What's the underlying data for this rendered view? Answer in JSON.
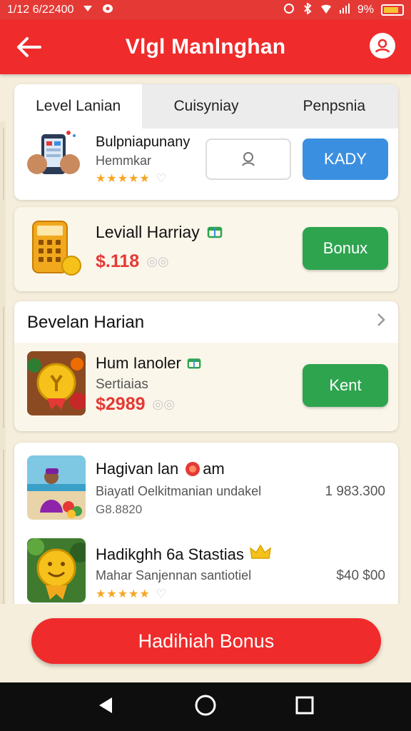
{
  "status_bar": {
    "time": "1/12 6/22400",
    "battery": "9%"
  },
  "header": {
    "title": "Vlgl Manlnghan",
    "back_icon": "arrow-left-icon",
    "profile_icon": "user-icon"
  },
  "tabs": [
    {
      "label": "Level Lanian",
      "active": true
    },
    {
      "label": "Cuisyniay",
      "active": false
    },
    {
      "label": "Penpsnia",
      "active": false
    }
  ],
  "featured_item": {
    "name": "Bulpniapunany",
    "subtitle": "Hemmkar",
    "rating": 5,
    "action_icon": "search-user-icon",
    "action_label": "KADY"
  },
  "level_card": {
    "title": "Leviall Harriay",
    "price": "$.118",
    "button_label": "Bonux"
  },
  "daily_section": {
    "header": "Bevelan Harian",
    "item": {
      "name": "Hum Ianoler",
      "subtitle": "Sertiaias",
      "price": "$2989",
      "button_label": "Kent"
    }
  },
  "list": [
    {
      "name": "Hagivan lan",
      "name_suffix": "am",
      "description": "Biayatl Oelkitmanian undakel",
      "extra": "G8.8820",
      "amount": "1 983.300"
    },
    {
      "name": "Hadikghh 6a Stastias",
      "description": "Mahar Sanjennan santiotiel",
      "rating": 5,
      "amount": "$40 $00"
    }
  ],
  "bottom_button": {
    "label": "Hadihiah Bonus"
  },
  "colors": {
    "primary_red": "#ef2b2b",
    "green": "#2ea44f",
    "blue": "#3b8fe0",
    "star": "#f5a623",
    "background": "#f6eedc"
  }
}
